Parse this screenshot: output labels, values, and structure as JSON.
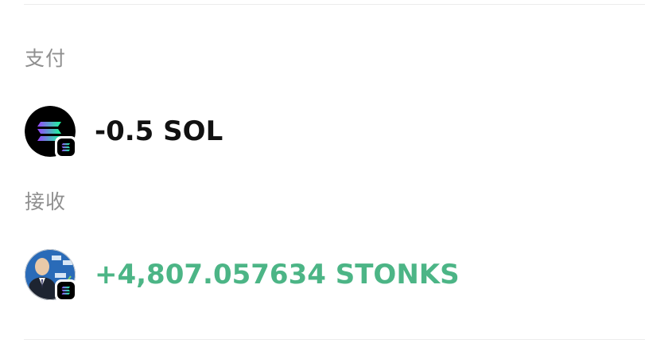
{
  "pay": {
    "label": "支付",
    "amount": "-0.5 SOL",
    "token_icon": "solana-logo-icon",
    "chain_badge_icon": "solana-chain-badge-icon"
  },
  "receive": {
    "label": "接收",
    "amount": "+4,807.057634 STONKS",
    "token_icon": "stonks-token-icon",
    "chain_badge_icon": "solana-chain-badge-icon"
  },
  "colors": {
    "label_gray": "#8f8f8f",
    "pay_amount": "#111111",
    "receive_amount": "#4cb586",
    "divider": "#ececec"
  }
}
